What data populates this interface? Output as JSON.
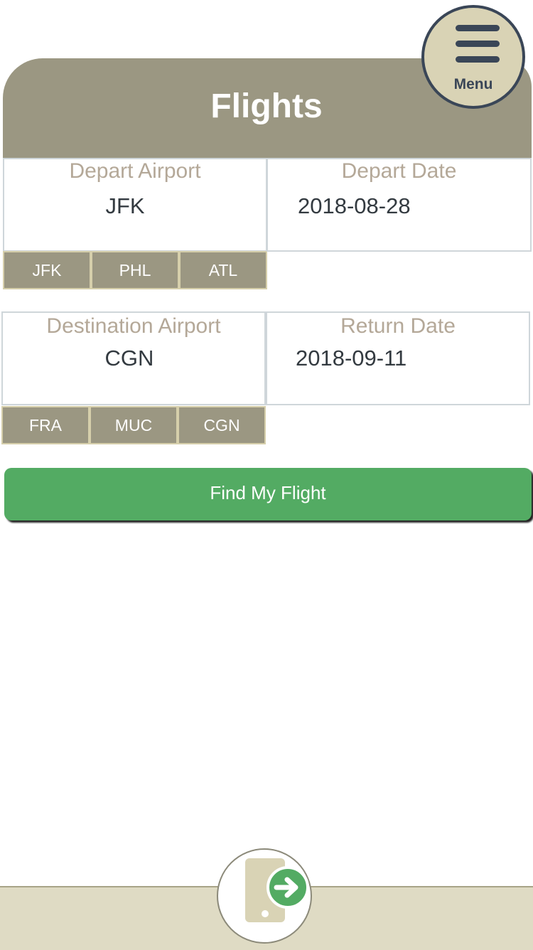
{
  "header": {
    "title": "Flights"
  },
  "menu": {
    "label": "Menu"
  },
  "depart": {
    "label": "Depart Airport",
    "value": "JFK",
    "chips": [
      "JFK",
      "PHL",
      "ATL"
    ]
  },
  "depart_date": {
    "label": "Depart Date",
    "value": "2018-08-28"
  },
  "destination": {
    "label": "Destination Airport",
    "value": "CGN",
    "chips": [
      "FRA",
      "MUC",
      "CGN"
    ]
  },
  "return_date": {
    "label": "Return Date",
    "value": "2018-09-11"
  },
  "find_button": {
    "label": "Find My Flight"
  },
  "colors": {
    "header": "#9b9782",
    "accent_green": "#53ab63",
    "menu_bg": "#d9d3b5",
    "footer": "#dfdbc4"
  },
  "icons": {
    "menu": "hamburger-icon",
    "fab": "phone-exit-icon"
  }
}
